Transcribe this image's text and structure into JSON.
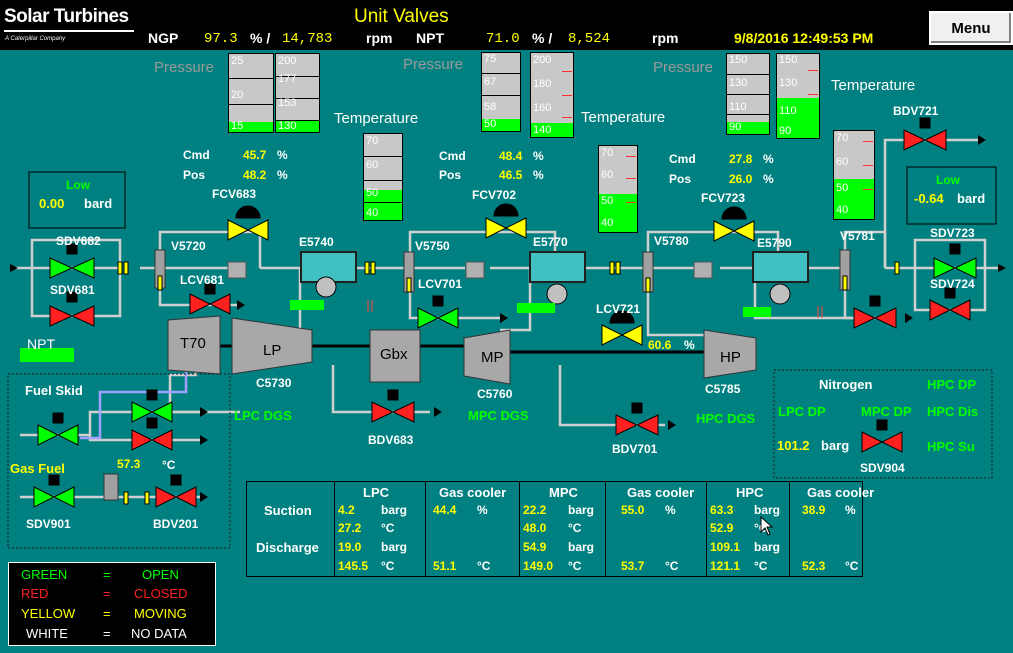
{
  "header": {
    "logo": "Solar Turbines",
    "logo_sub": "A Caterpillar Company",
    "title": "Unit Valves",
    "ngp_label": "NGP",
    "ngp_pct": "97.3",
    "pct_sep": "% /",
    "ngp_rpm": "14,783",
    "rpm": "rpm",
    "npt_label": "NPT",
    "npt_pct": "71.0",
    "npt_rpm": "8,524",
    "datetime": "9/8/2016 12:49:53 PM",
    "menu": "Menu"
  },
  "labels": {
    "pressure": "Pressure",
    "temperature": "Temperature",
    "cmd": "Cmd",
    "pos": "Pos",
    "pct": "%",
    "low": "Low",
    "bard": "bard",
    "barg": "barg",
    "degc": "°C"
  },
  "gauges": {
    "lp_press_a": [
      "25",
      "20",
      "15"
    ],
    "lp_press_b": [
      "200",
      "177",
      "153",
      "130"
    ],
    "lp_temp": [
      "70",
      "60",
      "50",
      "40"
    ],
    "mp_press_a": [
      "75",
      "67",
      "58",
      "50"
    ],
    "mp_press_b": [
      "200",
      "180",
      "160",
      "140"
    ],
    "mp_temp": [
      "70",
      "60",
      "50",
      "40"
    ],
    "hp_press_a": [
      "150",
      "130",
      "110",
      "90"
    ],
    "hp_press_b": [
      "150",
      "130",
      "110",
      "90"
    ],
    "hp_temp": [
      "70",
      "60",
      "50",
      "40"
    ]
  },
  "fcv683": {
    "tag": "FCV683",
    "cmd": "45.7",
    "pos": "48.2"
  },
  "fcv702": {
    "tag": "FCV702",
    "cmd": "48.4",
    "pos": "46.5"
  },
  "fcv723": {
    "tag": "FCV723",
    "cmd": "27.8",
    "pos": "26.0"
  },
  "low_left": {
    "value": "0.00"
  },
  "low_right": {
    "value": "-0.64"
  },
  "tags": {
    "sdv682": "SDV682",
    "sdv681": "SDV681",
    "v5720": "V5720",
    "lcv681": "LCV681",
    "e5740": "E5740",
    "v5750": "V5750",
    "lcv701": "LCV701",
    "e5770": "E5770",
    "v5780": "V5780",
    "e5790": "E5790",
    "v5781": "V5781",
    "bdv721": "BDV721",
    "sdv723": "SDV723",
    "sdv724": "SDV724",
    "lcv721": "LCV721",
    "t70": "T70",
    "lp": "LP",
    "gbx": "Gbx",
    "mp": "MP",
    "hp": "HP",
    "c5730": "C5730",
    "c5760": "C5760",
    "c5785": "C5785",
    "npt": "NPT",
    "bdv683": "BDV683",
    "bdv701": "BDV701",
    "lpc_dgs": "LPC DGS",
    "mpc_dgs": "MPC DGS",
    "hpc_dgs": "HPC DGS",
    "fuel_skid": "Fuel Skid",
    "gas_fuel": "Gas Fuel",
    "sdv901": "SDV901",
    "bdv201": "BDV201",
    "nitrogen": "Nitrogen",
    "sdv904": "SDV904",
    "lpc_dp": "LPC DP",
    "mpc_dp": "MPC DP",
    "hpc_dp": "HPC DP",
    "hpc_dis": "HPC Dis",
    "hpc_su": "HPC Su"
  },
  "values": {
    "lcv721_pct": "60.6",
    "fuel_temp": "57.3",
    "nitrogen_barg": "101.2"
  },
  "table": {
    "row_suction": "Suction",
    "row_discharge": "Discharge",
    "lpc": {
      "header": "LPC",
      "s_p": "4.2",
      "s_t": "27.2",
      "d_p": "19.0",
      "d_t": "145.5"
    },
    "gc1": {
      "header": "Gas cooler",
      "s": "44.4",
      "d": "51.1"
    },
    "mpc": {
      "header": "MPC",
      "s_p": "22.2",
      "s_t": "48.0",
      "d_p": "54.9",
      "d_t": "149.0"
    },
    "gc2": {
      "header": "Gas cooler",
      "s": "55.0",
      "d": "53.7"
    },
    "hpc": {
      "header": "HPC",
      "s_p": "63.3",
      "s_t": "52.9",
      "d_p": "109.1",
      "d_t": "121.1"
    },
    "gc3": {
      "header": "Gas cooler",
      "s": "38.9",
      "d": "52.3"
    }
  },
  "legend": [
    {
      "k": "GREEN",
      "eq": "=",
      "v": "OPEN",
      "color": "#00ff00"
    },
    {
      "k": "RED",
      "eq": "=",
      "v": "CLOSED",
      "color": "#ff2020"
    },
    {
      "k": "YELLOW",
      "eq": "=",
      "v": "MOVING",
      "color": "#ffff00"
    },
    {
      "k": "WHITE",
      "eq": "=",
      "v": "NO DATA",
      "color": "#ffffff"
    }
  ],
  "colors": {
    "background": "#008080",
    "open": "#00ff00",
    "closed": "#ff2020",
    "moving": "#ffff00"
  }
}
